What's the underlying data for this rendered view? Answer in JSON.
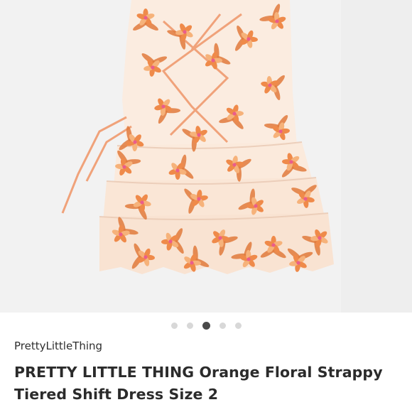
{
  "listing": {
    "brand": "PrettyLittleThing",
    "title": "PRETTY LITTLE THING  Orange Floral Strappy Tiered Shift Dress Size 2"
  },
  "carousel": {
    "image_count": 5,
    "active_index": 2
  },
  "photo": {
    "subject": "orange-floral-dress-photo",
    "colors": {
      "background": "#f3f3f3",
      "fabric": "#fbeee0",
      "petal_orange": "#ef8a4a",
      "petal_light": "#f6b27a",
      "petal_pink": "#ea5d8c",
      "leaf": "#e07a3c"
    }
  }
}
